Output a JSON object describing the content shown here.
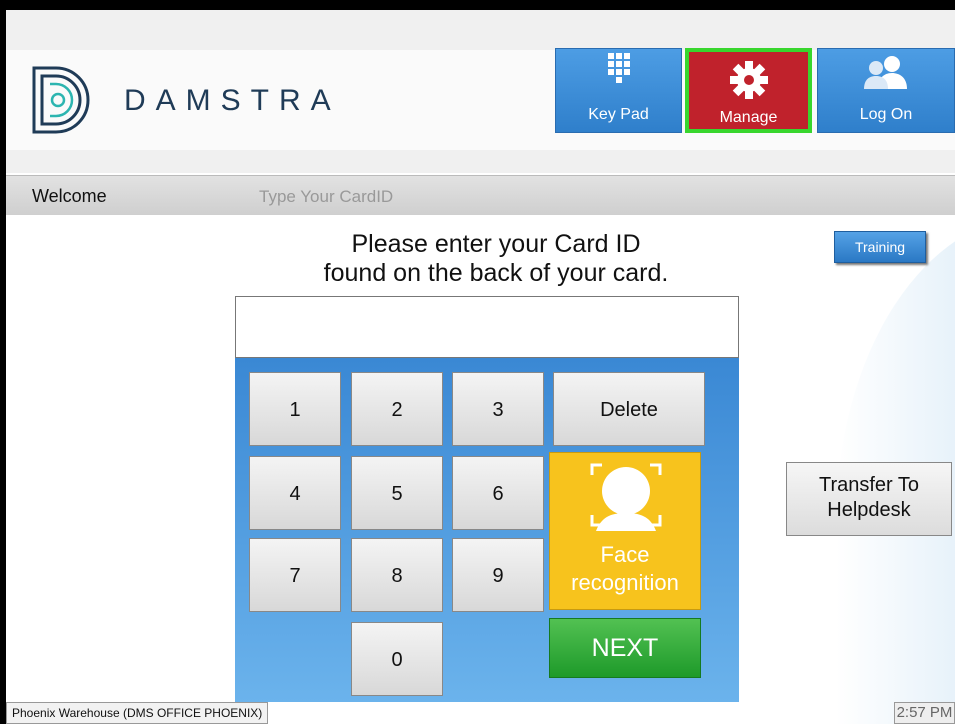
{
  "header": {
    "brand": "DAMSTRA",
    "buttons": {
      "keypad": "Key Pad",
      "manage": "Manage",
      "logon": "Log On"
    }
  },
  "welcome_bar": {
    "welcome": "Welcome",
    "type_card": "Type Your CardID"
  },
  "main": {
    "prompt_line1": "Please enter your Card ID",
    "prompt_line2": "found on the back of your card.",
    "training": "Training",
    "card_input_value": "",
    "transfer_line1": "Transfer To",
    "transfer_line2": "Helpdesk"
  },
  "keypad": {
    "keys": [
      "1",
      "2",
      "3",
      "4",
      "5",
      "6",
      "7",
      "8",
      "9",
      "0"
    ],
    "delete": "Delete",
    "face_line1": "Face",
    "face_line2": "recognition",
    "next": "NEXT"
  },
  "footer": {
    "location": "Phoenix Warehouse (DMS OFFICE PHOENIX)",
    "time": "2:57 PM"
  },
  "colors": {
    "brand": "#1f3b57",
    "accent_blue": "#2f7fcb",
    "manage_red": "#c0222c",
    "manage_border": "#38d62e",
    "face_yellow": "#f7c31d",
    "next_green": "#1e9a2a"
  },
  "icons": {
    "logo": "damstra-logo-icon",
    "keypad": "keypad-grid-icon",
    "manage": "gear-icon",
    "logon": "users-icon",
    "face": "face-scan-icon"
  }
}
